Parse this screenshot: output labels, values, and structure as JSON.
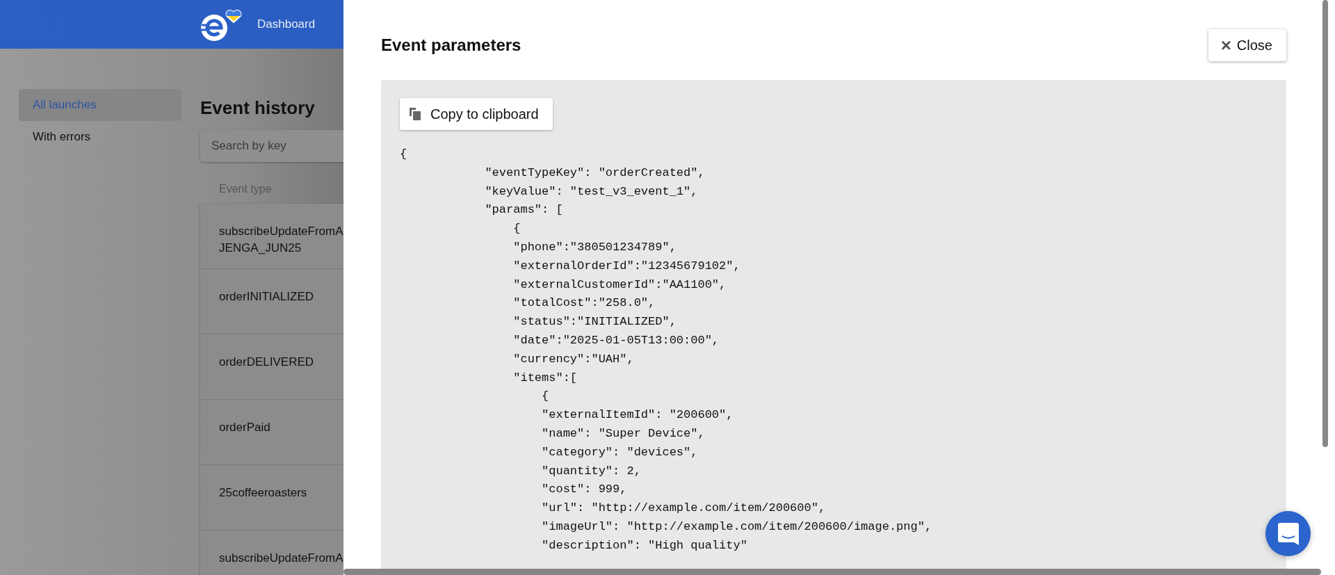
{
  "header": {
    "nav": [
      {
        "label": "Dashboard"
      }
    ]
  },
  "sidebar": {
    "items": [
      {
        "label": "All launches",
        "selected": true
      },
      {
        "label": "With errors",
        "selected": false
      }
    ]
  },
  "content": {
    "title": "Event history",
    "search": {
      "placeholder": "Search by key"
    },
    "table": {
      "columns": [
        "Event type"
      ],
      "rows": [
        {
          "lines": [
            "subscribeUpdateFromA",
            "JENGA_JUN25"
          ]
        },
        {
          "lines": [
            "orderINITIALIZED"
          ]
        },
        {
          "lines": [
            "orderDELIVERED"
          ]
        },
        {
          "lines": [
            "orderPaid"
          ]
        },
        {
          "lines": [
            "25coffeeroasters"
          ]
        },
        {
          "lines": [
            "subscribeUpdateFromA"
          ]
        }
      ]
    }
  },
  "modal": {
    "title": "Event parameters",
    "close_button": {
      "icon": "×",
      "label": "Close"
    },
    "copy_button": {
      "label": "Copy to clipboard"
    },
    "code": "{\n            \"eventTypeKey\": \"orderCreated\",\n            \"keyValue\": \"test_v3_event_1\",\n            \"params\": [\n                {\n                \"phone\":\"380501234789\",\n                \"externalOrderId\":\"12345679102\",\n                \"externalCustomerId\":\"AA1100\",\n                \"totalCost\":\"258.0\",\n                \"status\":\"INITIALIZED\",\n                \"date\":\"2025-01-05T13:00:00\",\n                \"currency\":\"UAH\",\n                \"items\":[\n                    {\n                    \"externalItemId\": \"200600\",\n                    \"name\": \"Super Device\",\n                    \"category\": \"devices\",\n                    \"quantity\": 2,\n                    \"cost\": 999,\n                    \"url\": \"http://example.com/item/200600\",\n                    \"imageUrl\": \"http://example.com/item/200600/image.png\",\n                    \"description\": \"High quality\""
  }
}
